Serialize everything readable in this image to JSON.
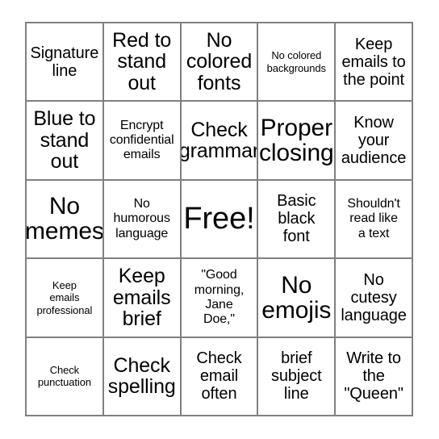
{
  "card": {
    "type": "bingo-card",
    "columns": 5,
    "rows": 5,
    "free_space_index": 12,
    "colors": {
      "background": "#ffffff",
      "grid_line": "#808080",
      "text": "#000000"
    },
    "cells": [
      {
        "text": "Signature\nline",
        "size": "md"
      },
      {
        "text": "Red to\nstand\nout",
        "size": "lg"
      },
      {
        "text": "No\ncolored\nfonts",
        "size": "lg"
      },
      {
        "text": "No colored\nbackgrounds",
        "size": "xs"
      },
      {
        "text": "Keep\nemails to\nthe point",
        "size": "md"
      },
      {
        "text": "Blue to\nstand\nout",
        "size": "lg"
      },
      {
        "text": "Encrypt\nconfidential\nemails",
        "size": "sm"
      },
      {
        "text": "Check\ngrammar",
        "size": "lg"
      },
      {
        "text": "Proper\nclosing",
        "size": "xl"
      },
      {
        "text": "Know\nyour\naudience",
        "size": "md"
      },
      {
        "text": "No\nmemes",
        "size": "xl"
      },
      {
        "text": "No\nhumorous\nlanguage",
        "size": "sm"
      },
      {
        "text": "Free!",
        "size": "xxl"
      },
      {
        "text": "Basic\nblack\nfont",
        "size": "md"
      },
      {
        "text": "Shouldn't\nread like\na text",
        "size": "sm"
      },
      {
        "text": "Keep\nemails\nprofessional",
        "size": "xs"
      },
      {
        "text": "Keep\nemails\nbrief",
        "size": "lg"
      },
      {
        "text": "\"Good\nmorning,\nJane\nDoe,\"",
        "size": "sm"
      },
      {
        "text": "No\nemojis",
        "size": "xl"
      },
      {
        "text": "No\ncutesy\nlanguage",
        "size": "md"
      },
      {
        "text": "Check\npunctuation",
        "size": "xs"
      },
      {
        "text": "Check\nspelling",
        "size": "lg"
      },
      {
        "text": "Check\nemail\noften",
        "size": "md"
      },
      {
        "text": "brief\nsubject\nline",
        "size": "md"
      },
      {
        "text": "Write to\nthe\n\"Queen\"",
        "size": "md"
      }
    ]
  }
}
